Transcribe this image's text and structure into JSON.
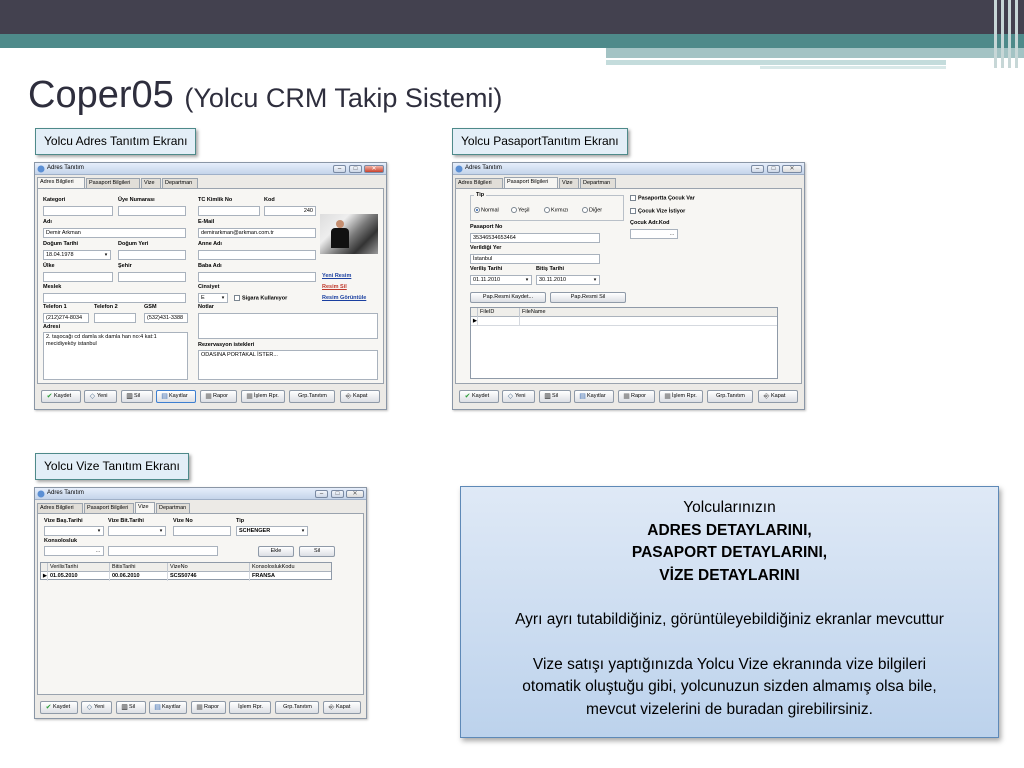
{
  "slide": {
    "title": "Coper05",
    "subtitle": "(Yolcu CRM Takip Sistemi)",
    "labels": {
      "adres": "Yolcu Adres Tanıtım Ekranı",
      "pasaport": "Yolcu PasaportTanıtım Ekranı",
      "vize": "Yolcu Vize Tanıtım Ekranı"
    },
    "colors": {
      "topbar": "#43414f",
      "teal": "#4e8a8a",
      "info_bg": "#cddcf0"
    }
  },
  "window": {
    "title": "Adres Tanıtım",
    "tabs": [
      "Adres Bilgileri",
      "Pasaport Bilgileri",
      "Vize",
      "Departman"
    ],
    "min": "–",
    "max": "□",
    "close": "✕"
  },
  "toolbar": {
    "kaydet": "Kaydet",
    "yeni": "Yeni",
    "sil": "Sil",
    "kayitlar": "Kayıtlar",
    "rapor": "Rapor",
    "islem": "İşlem Rpr.",
    "grp": "Grp.Tanıtım",
    "kapat": "Kapat"
  },
  "adres": {
    "kategori_label": "Kategori",
    "kategori": "",
    "uye_label": "Üye Numarası",
    "uye": "",
    "tc_label": "TC Kimlik No",
    "tc": "",
    "kod_label": "Kod",
    "kod": "240",
    "adi_label": "Adı",
    "adi": "Demir Arkman",
    "email_label": "E-Mail",
    "email": "demirarkman@arkman.com.tr",
    "dogum_tarihi_label": "Doğum Tarihi",
    "dogum_tarihi": "18.04.1978",
    "dogum_yeri_label": "Doğum Yeri",
    "dogum_yeri": "",
    "anne_label": "Anne Adı",
    "anne": "",
    "ulke_label": "Ülke",
    "ulke": "",
    "sehir_label": "Şehir",
    "sehir": "",
    "baba_label": "Baba Adı",
    "baba": "",
    "meslek_label": "Meslek",
    "meslek": "",
    "cinsiyet_label": "Cinsiyet",
    "cinsiyet": "E",
    "sigara": "Sigara Kullanıyor",
    "yeni_resim": "Yeni Resim",
    "resim_sil": "Resim Sil",
    "resim_goruntule": "Resim Görüntüle",
    "tel1_label": "Telefon 1",
    "tel1": "(212)274-8034",
    "tel2_label": "Telefon 2",
    "tel2": "",
    "gsm_label": "GSM",
    "gsm": "(532)431-3388",
    "notlar_label": "Notlar",
    "notlar": "",
    "adres_label": "Adresi",
    "adres": "2. taşocağı cd damla sk damla han no:4 kat:1 mecidiyeköy istanbul",
    "rez_label": "Rezervasyon istekleri",
    "rez": "ODASINA PORTAKAL İSTER..."
  },
  "pasaport": {
    "tip_label": "Tip",
    "radios": [
      "Normal",
      "Yeşil",
      "Kırmızı",
      "Diğer"
    ],
    "cocuk_var": "Pasaportta Çocuk Var",
    "cocuk_vize": "Çocuk Vize İstiyor",
    "cocuk_kod_label": "Çocuk Adr.Kod",
    "no_label": "Pasaport No",
    "no": "35346534653464",
    "verildigi_label": "Verildiği Yer",
    "verildigi": "İstanbul",
    "verilis_label": "Veriliş Tarihi",
    "verilis": "01.11.2010",
    "bitis_label": "Bitiş Tarihi",
    "bitis": "30.11.2010",
    "kaydet_btn": "Pap.Resmi Kaydet...",
    "sil_btn": "Pap.Resmi Sil",
    "grid_cols": [
      "FileID",
      "FileName"
    ]
  },
  "vize": {
    "bas_label": "Vize Baş.Tarihi",
    "bit_label": "Vize Bit.Tarihi",
    "no_label": "Vize No",
    "tip_label": "Tip",
    "tip": "SCHENGER",
    "konsolosluk_label": "Konsolosluk",
    "ekle": "Ekle",
    "sil": "Sil",
    "grid_cols": [
      "VerilisTarihi",
      "BitisTarihi",
      "VizeNo",
      "KonsoloslukKodu"
    ],
    "rows": [
      [
        "01.05.2010",
        "00.06.2010",
        "SCS50746",
        "FRANSA"
      ]
    ]
  },
  "info": {
    "line1": "Yolcularınızın",
    "line2": "ADRES DETAYLARINI,",
    "line3": "PASAPORT DETAYLARINI,",
    "line4": "VİZE DETAYLARINI",
    "para1": "Ayrı ayrı tutabildiğiniz, görüntüleyebildiğiniz ekranlar mevcuttur",
    "para2_l1": "Vize satışı yaptığınızda Yolcu Vize ekranında vize bilgileri",
    "para2_l2": "otomatik oluştuğu gibi, yolcunuzun sizden almamış olsa bile,",
    "para2_l3": "mevcut vizelerini de buradan girebilirsiniz."
  }
}
